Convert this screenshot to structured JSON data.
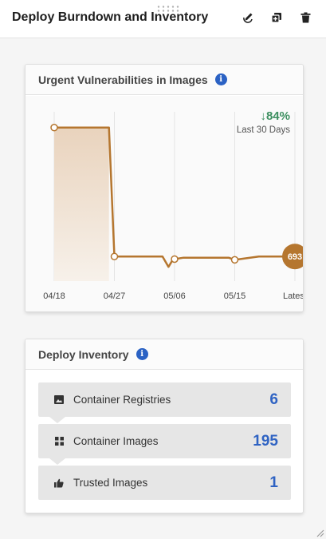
{
  "header": {
    "title": "Deploy Burndown and Inventory",
    "icons": [
      "edit-icon",
      "copy-icon",
      "trash-icon"
    ]
  },
  "vuln_card": {
    "title": "Urgent Vulnerabilities in Images",
    "trend_value": "↓84%",
    "trend_period": "Last 30 Days",
    "latest_badge": "693",
    "colors": {
      "line": "#b5762f",
      "trend": "#3d8f60"
    }
  },
  "chart_data": {
    "type": "line",
    "title": "Urgent Vulnerabilities in Images",
    "xlabel": "",
    "ylabel": "",
    "categories": [
      "04/18",
      "04/27",
      "05/06",
      "05/15",
      "Latest"
    ],
    "series": [
      {
        "values": [
          {
            "x": 0,
            "y": 4330
          },
          {
            "x": 0.91,
            "y": 4330
          },
          {
            "x": 1.0,
            "y": 693
          },
          {
            "x": 1.8,
            "y": 693
          },
          {
            "x": 1.9,
            "y": 400
          },
          {
            "x": 1.97,
            "y": 600
          },
          {
            "x": 2.0,
            "y": 620
          },
          {
            "x": 2.15,
            "y": 660
          },
          {
            "x": 2.9,
            "y": 660
          },
          {
            "x": 3.0,
            "y": 600
          },
          {
            "x": 3.4,
            "y": 693
          },
          {
            "x": 4.0,
            "y": 693
          }
        ]
      }
    ],
    "markers_at": [
      0,
      1.0,
      2.0,
      3.0
    ],
    "ylim": [
      0,
      5000
    ],
    "grid": "vertical"
  },
  "inventory_card": {
    "title": "Deploy Inventory",
    "items": [
      {
        "label": "Container Registries",
        "count": "6",
        "icon": "image-icon"
      },
      {
        "label": "Container Images",
        "count": "195",
        "icon": "grid-icon"
      },
      {
        "label": "Trusted Images",
        "count": "1",
        "icon": "thumbs-up-icon"
      }
    ],
    "count_color": "#2f63c3"
  }
}
